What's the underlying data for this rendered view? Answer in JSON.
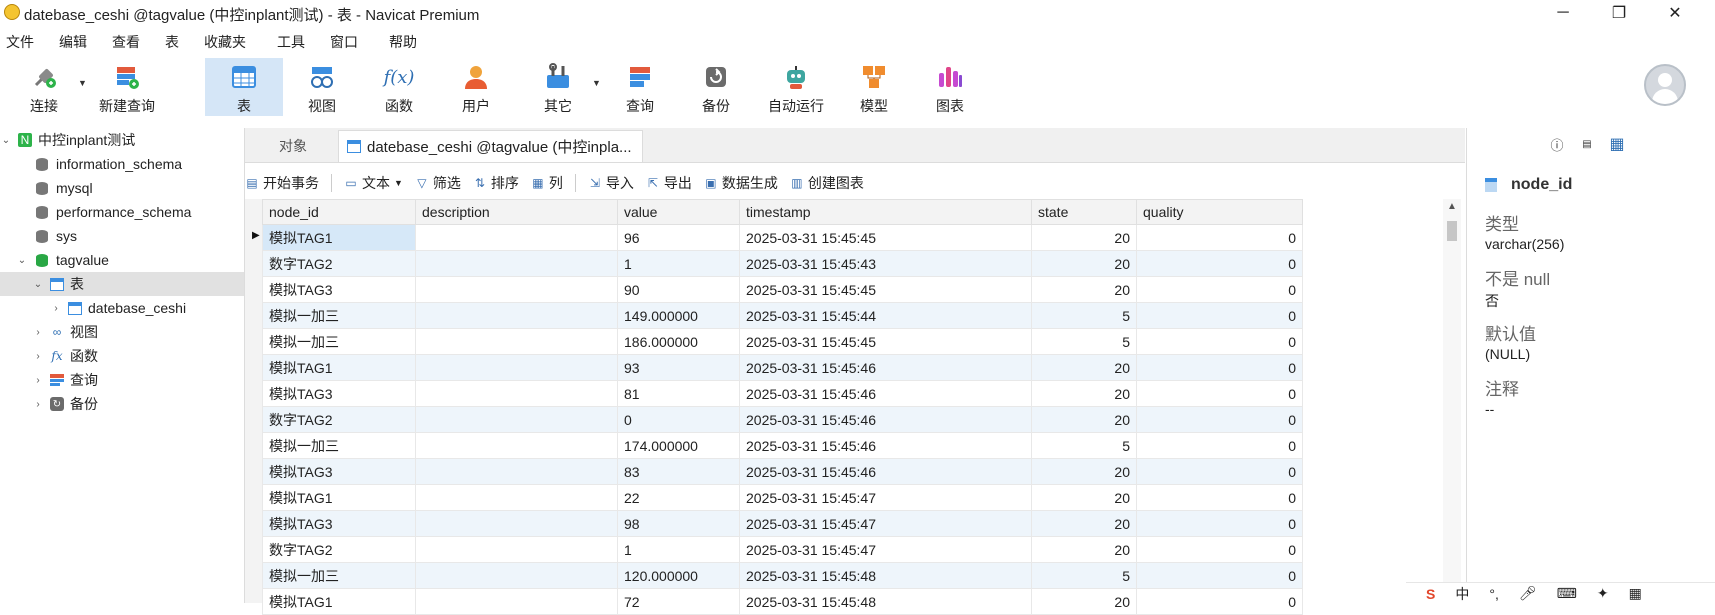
{
  "window": {
    "title": "datebase_ceshi @tagvalue (中控inplant测试) - 表 - Navicat Premium",
    "minimize": "─",
    "maximize": "❐",
    "close": "✕"
  },
  "menu": [
    "文件",
    "编辑",
    "查看",
    "表",
    "收藏夹",
    "工具",
    "窗口",
    "帮助"
  ],
  "toolbar": {
    "connect": "连接",
    "new_query": "新建查询",
    "table": "表",
    "view": "视图",
    "function": "函数",
    "user": "用户",
    "other": "其它",
    "query": "查询",
    "backup": "备份",
    "automation": "自动运行",
    "model": "模型",
    "chart": "图表"
  },
  "sidebar": {
    "connection": "中控inplant测试",
    "databases": [
      "information_schema",
      "mysql",
      "performance_schema",
      "sys",
      "tagvalue"
    ],
    "tables_group": "表",
    "table_item": "datebase_ceshi",
    "views": "视图",
    "functions": "函数",
    "queries": "查询",
    "backups": "备份"
  },
  "tabs": {
    "objects": "对象",
    "active": "datebase_ceshi @tagvalue (中控inpla..."
  },
  "actions": {
    "begin_tx": "开始事务",
    "text": "文本",
    "filter": "筛选",
    "sort": "排序",
    "columns": "列",
    "import": "导入",
    "export": "导出",
    "data_gen": "数据生成",
    "create_chart": "创建图表"
  },
  "grid": {
    "columns": [
      "node_id",
      "description",
      "value",
      "timestamp",
      "state",
      "quality"
    ],
    "rows": [
      [
        "模拟TAG1",
        "",
        "96",
        "2025-03-31 15:45:45",
        "20",
        "0"
      ],
      [
        "数字TAG2",
        "",
        "1",
        "2025-03-31 15:45:43",
        "20",
        "0"
      ],
      [
        "模拟TAG3",
        "",
        "90",
        "2025-03-31 15:45:45",
        "20",
        "0"
      ],
      [
        "模拟一加三",
        "",
        "149.000000",
        "2025-03-31 15:45:44",
        "5",
        "0"
      ],
      [
        "模拟一加三",
        "",
        "186.000000",
        "2025-03-31 15:45:45",
        "5",
        "0"
      ],
      [
        "模拟TAG1",
        "",
        "93",
        "2025-03-31 15:45:46",
        "20",
        "0"
      ],
      [
        "模拟TAG3",
        "",
        "81",
        "2025-03-31 15:45:46",
        "20",
        "0"
      ],
      [
        "数字TAG2",
        "",
        "0",
        "2025-03-31 15:45:46",
        "20",
        "0"
      ],
      [
        "模拟一加三",
        "",
        "174.000000",
        "2025-03-31 15:45:46",
        "5",
        "0"
      ],
      [
        "模拟TAG3",
        "",
        "83",
        "2025-03-31 15:45:46",
        "20",
        "0"
      ],
      [
        "模拟TAG1",
        "",
        "22",
        "2025-03-31 15:45:47",
        "20",
        "0"
      ],
      [
        "模拟TAG3",
        "",
        "98",
        "2025-03-31 15:45:47",
        "20",
        "0"
      ],
      [
        "数字TAG2",
        "",
        "1",
        "2025-03-31 15:45:47",
        "20",
        "0"
      ],
      [
        "模拟一加三",
        "",
        "120.000000",
        "2025-03-31 15:45:48",
        "5",
        "0"
      ],
      [
        "模拟TAG1",
        "",
        "72",
        "2025-03-31 15:45:48",
        "20",
        "0"
      ]
    ]
  },
  "field_panel": {
    "field_name": "node_id",
    "type_label": "类型",
    "type_value": "varchar(256)",
    "notnull_label": "不是 null",
    "notnull_value": "否",
    "default_label": "默认值",
    "default_value": "(NULL)",
    "comment_label": "注释",
    "comment_value": "--"
  },
  "tray": {
    "ime": "中",
    "punct": "°,"
  }
}
